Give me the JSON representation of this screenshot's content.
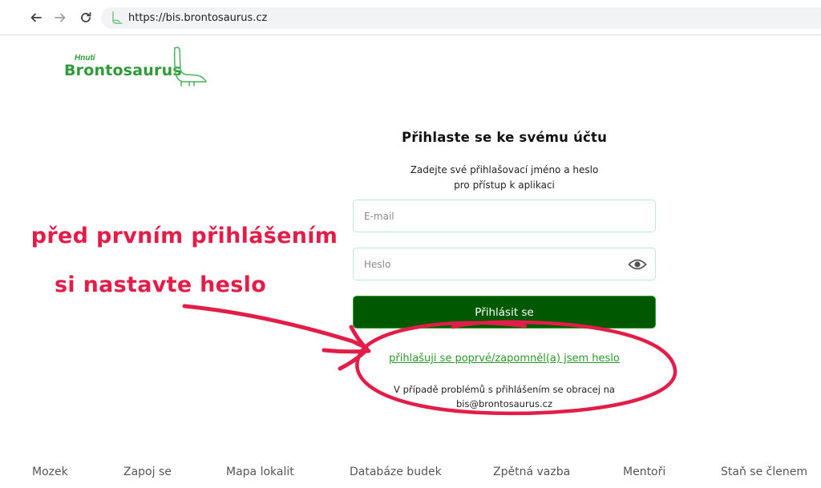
{
  "browser": {
    "url": "https://bis.brontosaurus.cz",
    "back_icon": "arrow-left-icon",
    "forward_icon": "arrow-right-icon",
    "reload_icon": "reload-icon",
    "site_icon": "dinosaur-favicon-icon"
  },
  "logo": {
    "small_text": "Hnutí",
    "big_text": "Brontosaurus",
    "color": "#2f9a3a"
  },
  "login": {
    "title": "Přihlaste se ke svému účtu",
    "subtitle_line1": "Zadejte své přihlašovací jméno a heslo",
    "subtitle_line2": "pro přístup k aplikaci",
    "email_placeholder": "E-mail",
    "password_placeholder": "Heslo",
    "submit_label": "Přihlásit se",
    "forgot_link": "přihlašuji se poprvé/zapomněl(a) jsem heslo",
    "contact_line1": "V případě problémů s přihlášením se obracej na",
    "contact_line2": "bis@brontosaurus.cz",
    "button_color": "#005900",
    "link_color": "#2a9a2a"
  },
  "annotation": {
    "line1": "před prvním přihlášením",
    "line2": "si nastavte heslo",
    "color": "#e11d48"
  },
  "footer": {
    "items": [
      "Mozek",
      "Zapoj se",
      "Mapa lokalit",
      "Databáze budek",
      "Zpětná vazba",
      "Mentoři",
      "Staň se členem"
    ]
  }
}
